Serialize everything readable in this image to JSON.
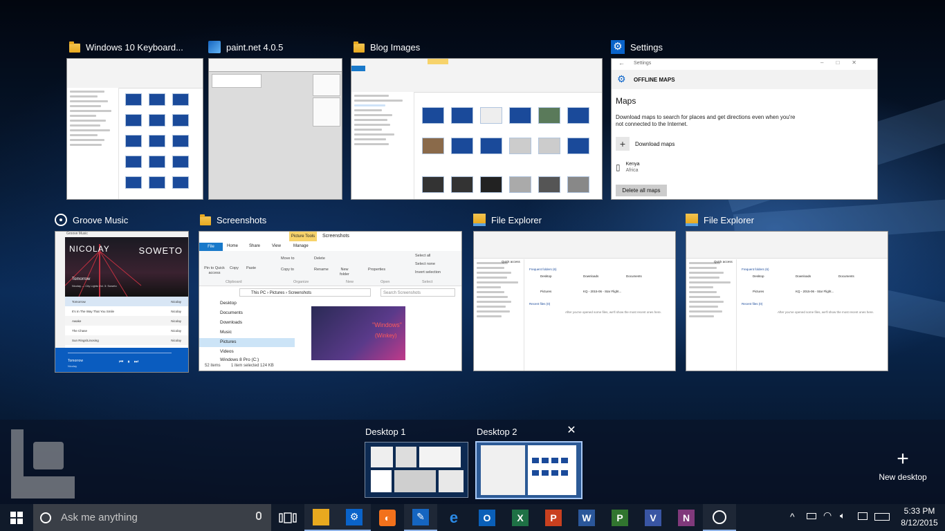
{
  "windows": [
    {
      "title": "Windows 10 Keyboard...",
      "icon": "folder-icon"
    },
    {
      "title": "paint.net 4.0.5",
      "icon": "paintnet-icon"
    },
    {
      "title": "Blog Images",
      "icon": "folder-icon"
    },
    {
      "title": "Settings",
      "icon": "gear-icon"
    },
    {
      "title": "Groove Music",
      "icon": "groove-icon"
    },
    {
      "title": "Screenshots",
      "icon": "folder-icon"
    },
    {
      "title": "File Explorer",
      "icon": "file-explorer-icon"
    },
    {
      "title": "File Explorer",
      "icon": "file-explorer-icon"
    }
  ],
  "settings_thumb": {
    "header": "Settings",
    "section": "OFFLINE MAPS",
    "heading": "Maps",
    "description": "Download maps to search for places and get directions even when you're not connected to the Internet.",
    "download_label": "Download maps",
    "map_name": "Kenya",
    "map_region": "Africa",
    "delete_label": "Delete all maps"
  },
  "groove_thumb": {
    "header": "Groove Music",
    "artist_big": "NICOLAY",
    "album_big": "SOWETO",
    "now_title": "Tomorrow",
    "now_sub": "Nicolay — City Lights Vol. 3: Soweto",
    "tracks": [
      {
        "name": "Tomorrow",
        "artist": "Nicolay"
      },
      {
        "name": "It's In The Way That You Smile",
        "artist": "Nicolay"
      },
      {
        "name": "Awake",
        "artist": "Nicolay"
      },
      {
        "name": "The Chase",
        "artist": "Nicolay"
      },
      {
        "name": "Sun Rings/Linosing",
        "artist": "Nicolay"
      }
    ],
    "player_title": "Tomorrow",
    "player_artist": "Nicolay"
  },
  "screenshots_thumb": {
    "ribbon_tabs": [
      "File",
      "Home",
      "Share",
      "View",
      "Manage"
    ],
    "picture_tools": "Picture Tools",
    "window_title": "Screenshots",
    "ribbon_groups": [
      "Clipboard",
      "Organize",
      "New",
      "Open",
      "Select"
    ],
    "buttons": {
      "pin": "Pin to Quick access",
      "copy": "Copy",
      "paste": "Paste",
      "move_to": "Move to",
      "copy_to": "Copy to",
      "delete": "Delete",
      "rename": "Rename",
      "new_folder": "New folder",
      "properties": "Properties",
      "select_all": "Select all",
      "select_none": "Select none",
      "invert": "Invert selection"
    },
    "path": [
      "This PC",
      "Pictures",
      "Screenshots"
    ],
    "search_placeholder": "Search Screenshots",
    "nav_items": [
      "Desktop",
      "Documents",
      "Downloads",
      "Music",
      "Pictures",
      "Videos",
      "Windows 8 Pro (C:)"
    ],
    "preview_text_1": "\"Windows\"",
    "preview_text_2": "(Winkey)",
    "status_items": "52 items",
    "status_selected": "1 item selected  124 KB"
  },
  "explorer_thumb": {
    "quick_access": "Quick access",
    "frequent": "Frequent folders (6)",
    "recent": "Recent files (0)",
    "folders": [
      "Desktop",
      "Downloads",
      "Documents",
      "Pictures",
      "KQ - 2015-06 - Star Flight..."
    ],
    "empty_msg": "After you've opened some files, we'll show the most recent ones here."
  },
  "desktops": [
    {
      "label": "Desktop 1",
      "active": false
    },
    {
      "label": "Desktop 2",
      "active": true
    }
  ],
  "new_desktop_label": "New desktop",
  "taskbar": {
    "search_placeholder": "Ask me anything",
    "apps": [
      {
        "icon": "file-explorer-icon",
        "color": "#e8a91f",
        "glyph": "",
        "active": true
      },
      {
        "icon": "settings-icon",
        "color": "#0a63c9",
        "glyph": "⚙",
        "active": true
      },
      {
        "icon": "firefox-icon",
        "color": "#f2711c",
        "glyph": "◐",
        "active": false
      },
      {
        "icon": "paintnet-icon",
        "color": "#1565c0",
        "glyph": "✎",
        "active": true
      },
      {
        "icon": "edge-icon",
        "color": "#1a6fd0",
        "glyph": "e",
        "active": false
      },
      {
        "icon": "outlook-icon",
        "color": "#0a5fb8",
        "glyph": "O",
        "active": false
      },
      {
        "icon": "excel-icon",
        "color": "#1e7145",
        "glyph": "X",
        "active": false
      },
      {
        "icon": "powerpoint-icon",
        "color": "#c9401f",
        "glyph": "P",
        "active": false
      },
      {
        "icon": "word-icon",
        "color": "#2b579a",
        "glyph": "W",
        "active": false
      },
      {
        "icon": "project-icon",
        "color": "#31752f",
        "glyph": "P",
        "active": false
      },
      {
        "icon": "visio-icon",
        "color": "#3955a3",
        "glyph": "V",
        "active": false
      },
      {
        "icon": "onenote-icon",
        "color": "#80397b",
        "glyph": "N",
        "active": false
      },
      {
        "icon": "groove-icon",
        "color": "#ffffff",
        "glyph": "◉",
        "active": true
      }
    ],
    "time": "5:33 PM",
    "date": "8/12/2015"
  }
}
